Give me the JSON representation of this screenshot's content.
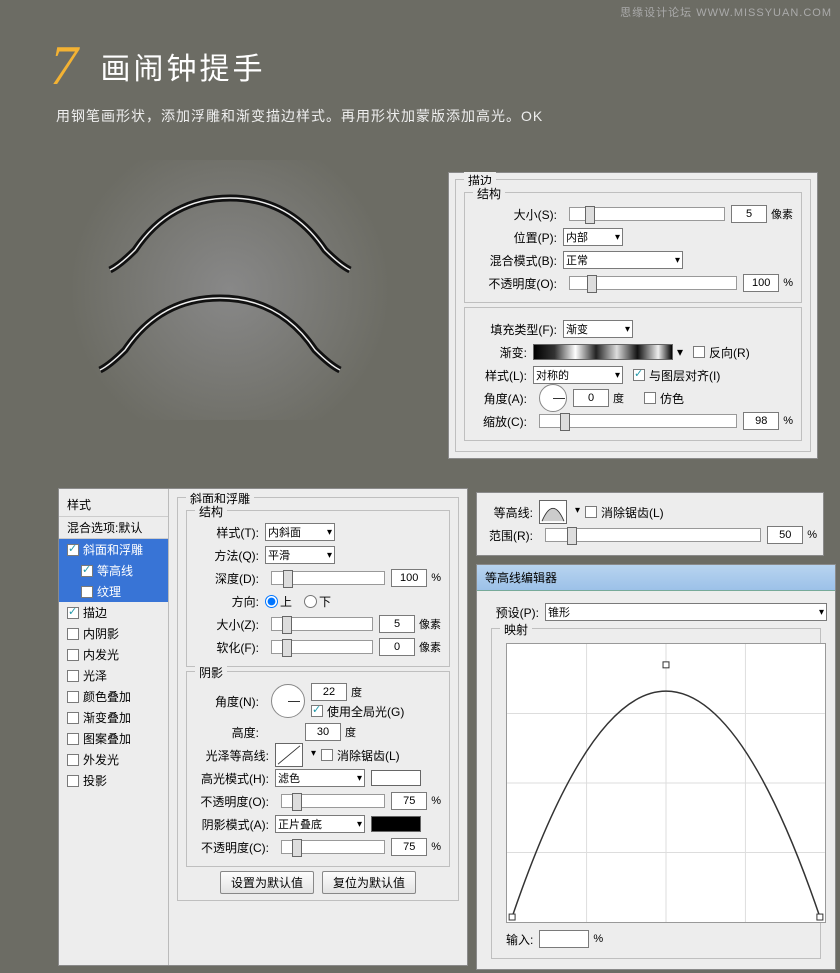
{
  "watermark": "思缘设计论坛  WWW.MISSYUAN.COM",
  "header": {
    "num": "7",
    "title": "画闹钟提手",
    "desc": "用钢笔画形状，添加浮雕和渐变描边样式。再用形状加蒙版添加高光。OK"
  },
  "stroke_panel": {
    "title": "描边",
    "struct_title": "结构",
    "size_lbl": "大小(S):",
    "size_val": "5",
    "size_unit": "像素",
    "pos_lbl": "位置(P):",
    "pos_val": "内部",
    "blend_lbl": "混合模式(B):",
    "blend_val": "正常",
    "opacity_lbl": "不透明度(O):",
    "opacity_val": "100",
    "opacity_unit": "%",
    "fill_lbl": "填充类型(F):",
    "fill_val": "渐变",
    "grad_lbl": "渐变:",
    "reverse_lbl": "反向(R)",
    "style_lbl": "样式(L):",
    "style_val": "对称的",
    "align_lbl": "与图层对齐(I)",
    "angle_lbl": "角度(A):",
    "angle_val": "0",
    "angle_unit": "度",
    "dither_lbl": "仿色",
    "scale_lbl": "缩放(C):",
    "scale_val": "98",
    "scale_unit": "%"
  },
  "styles": {
    "hdr": "样式",
    "blend_opts": "混合选项:默认",
    "bevel": "斜面和浮雕",
    "contour": "等高线",
    "texture": "纹理",
    "stroke": "描边",
    "inner_shadow": "内阴影",
    "inner_glow": "内发光",
    "satin": "光泽",
    "color_ov": "颜色叠加",
    "grad_ov": "渐变叠加",
    "pattern_ov": "图案叠加",
    "outer_glow": "外发光",
    "drop_shadow": "投影"
  },
  "bevel": {
    "title": "斜面和浮雕",
    "struct_title": "结构",
    "style_lbl": "样式(T):",
    "style_val": "内斜面",
    "tech_lbl": "方法(Q):",
    "tech_val": "平滑",
    "depth_lbl": "深度(D):",
    "depth_val": "100",
    "depth_unit": "%",
    "dir_lbl": "方向:",
    "dir_up": "上",
    "dir_down": "下",
    "size_lbl": "大小(Z):",
    "size_val": "5",
    "size_unit": "像素",
    "soft_lbl": "软化(F):",
    "soft_val": "0",
    "soft_unit": "像素",
    "shade_title": "阴影",
    "ang_lbl": "角度(N):",
    "ang_val": "22",
    "ang_unit": "度",
    "global_lbl": "使用全局光(G)",
    "alt_lbl": "高度:",
    "alt_val": "30",
    "alt_unit": "度",
    "gloss_lbl": "光泽等高线:",
    "aa_lbl": "消除锯齿(L)",
    "hi_mode_lbl": "高光模式(H):",
    "hi_mode_val": "滤色",
    "hi_op_lbl": "不透明度(O):",
    "hi_op_val": "75",
    "hi_op_unit": "%",
    "sh_mode_lbl": "阴影模式(A):",
    "sh_mode_val": "正片叠底",
    "sh_op_lbl": "不透明度(C):",
    "sh_op_val": "75",
    "sh_op_unit": "%",
    "btn_default": "设置为默认值",
    "btn_reset": "复位为默认值"
  },
  "contour_panel": {
    "lbl": "等高线:",
    "aa_lbl": "消除锯齿(L)",
    "range_lbl": "范围(R):",
    "range_val": "50",
    "range_unit": "%"
  },
  "editor": {
    "title": "等高线编辑器",
    "preset_lbl": "预设(P):",
    "preset_val": "锥形",
    "map_title": "映射",
    "input_lbl": "输入:",
    "input_unit": "%"
  }
}
